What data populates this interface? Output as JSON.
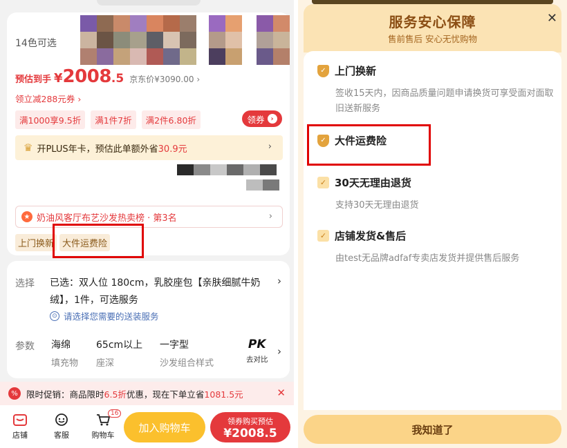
{
  "left": {
    "colors_label": "14色可选",
    "price": {
      "prefix": "预估到手",
      "currency": "¥",
      "integer": "2008",
      "decimal": ".5",
      "jd_price": "京东价¥3090.00",
      "jd_arrow": "›"
    },
    "coupon_get": "领立减288元券 ›",
    "promo_tags": [
      "满1000享9.5折",
      "满1件7折",
      "满2件6.80折"
    ],
    "coupon_button": "领券",
    "coupon_button_icon": "›",
    "plus_bar": {
      "prefix": "开PLUS年卡，预估此单额外省",
      "amount": "30.9元",
      "arrow": "›"
    },
    "rank_bar": {
      "text": "奶油风客厅布艺沙发热卖榜 · 第3名",
      "arrow": "›",
      "medal_icon": "★"
    },
    "service_tags": [
      "上门换新",
      "大件运费险"
    ],
    "select": {
      "label": "选择",
      "text": "已选：双人位 180cm，乳胶座包【亲肤细腻牛奶绒】，1件，可选服务",
      "arrow": "›",
      "ship_text": "请选择您需要的送装服务"
    },
    "params": {
      "label": "参数",
      "items": [
        {
          "value": "海绵",
          "name": "填充物"
        },
        {
          "value": "65cm以上",
          "name": "座深"
        },
        {
          "value": "一字型",
          "name": "沙发组合样式"
        }
      ],
      "pk_title": "PK",
      "pk_sub": "去对比",
      "arrow": "›"
    },
    "promo_banner": {
      "pre": "限时促销：商品限时",
      "discount": "6.5折",
      "mid": "优惠，现在下单立省",
      "save": "1081.5元",
      "close_icon": "✕"
    },
    "bottom_nav": [
      {
        "label": "店铺",
        "icon": "store-icon"
      },
      {
        "label": "客服",
        "icon": "chat-icon"
      },
      {
        "label": "购物车",
        "icon": "cart-icon",
        "badge": "16"
      }
    ],
    "add_cart_label": "加入购物车",
    "buy": {
      "line1": "领券购买预估",
      "line2": "¥2008.5"
    },
    "colors": {
      "accent_red": "#e4393c",
      "yellow": "#fbc02d",
      "gold": "#e3a33d"
    }
  },
  "right": {
    "title": "服务安心保障",
    "subtitle": "售前售后 安心无忧购物",
    "close_icon": "✕",
    "items": [
      {
        "title": "上门换新",
        "icon": "shield-icon",
        "desc": "签收15天内，因商品质量问题申请换货可享受面对面取旧送新服务"
      },
      {
        "title": "大件运费险",
        "icon": "shield-icon",
        "desc": ""
      },
      {
        "title": "30天无理由退货",
        "icon": "check-icon",
        "desc": "支持30天无理由退货"
      },
      {
        "title": "店铺发货&售后",
        "icon": "check-icon",
        "desc": "由test无品牌adfaf专卖店发货并提供售后服务"
      }
    ],
    "ok_label": "我知道了"
  }
}
